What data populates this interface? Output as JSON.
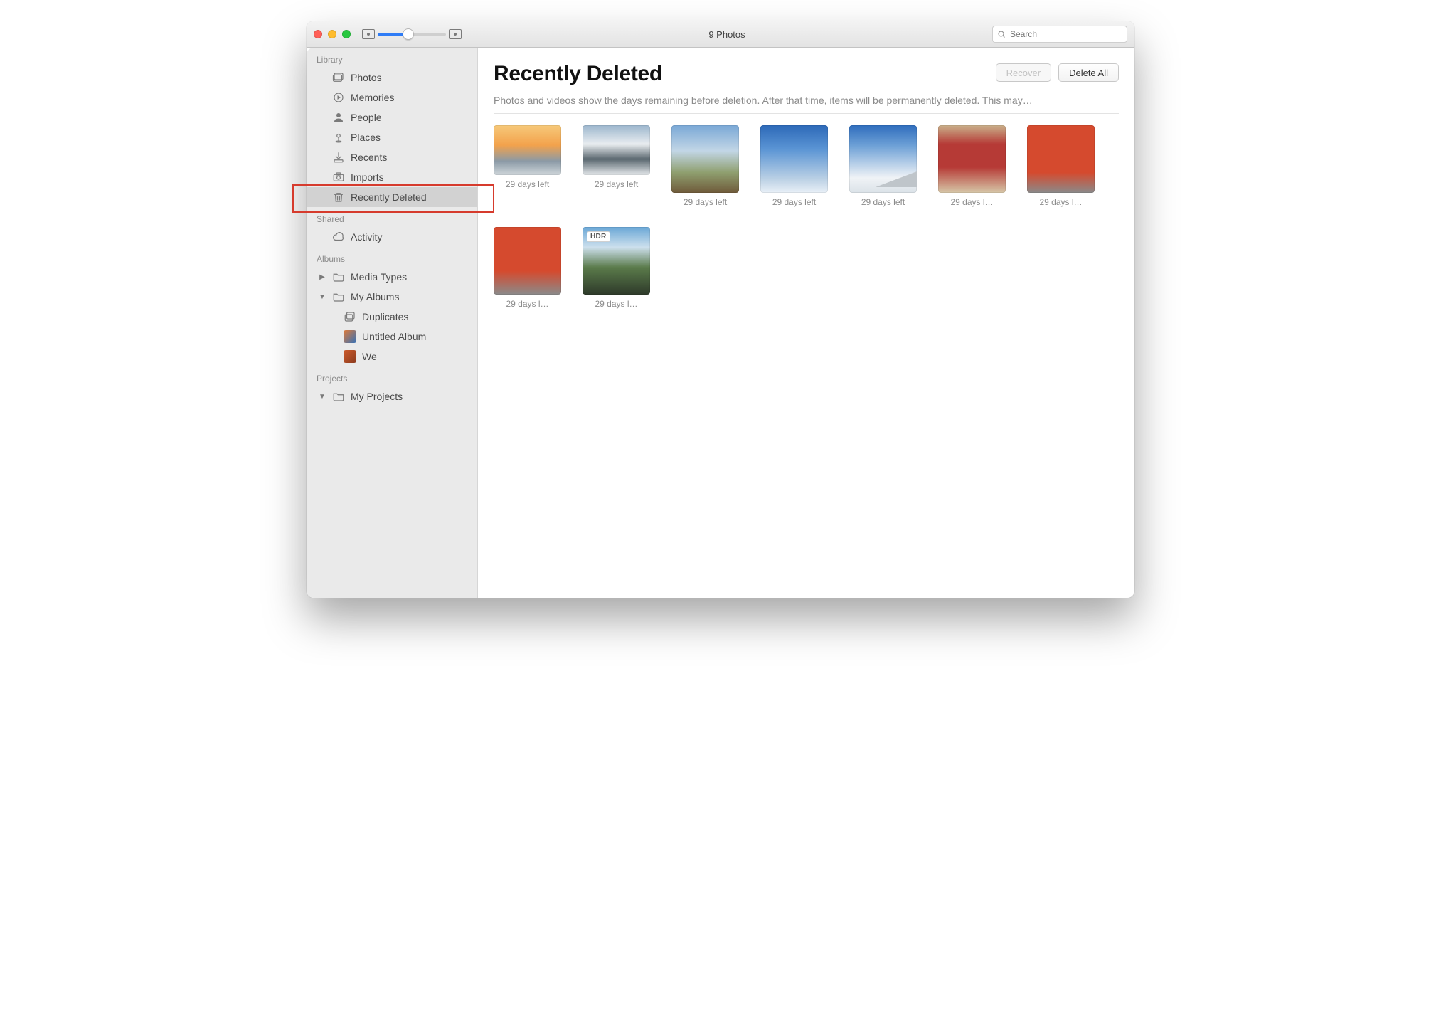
{
  "window": {
    "title": "9 Photos"
  },
  "search": {
    "placeholder": "Search"
  },
  "sidebar": {
    "sections": {
      "library": {
        "title": "Library",
        "items": [
          {
            "label": "Photos",
            "icon": "photos"
          },
          {
            "label": "Memories",
            "icon": "memories"
          },
          {
            "label": "People",
            "icon": "people"
          },
          {
            "label": "Places",
            "icon": "places"
          },
          {
            "label": "Recents",
            "icon": "recents"
          },
          {
            "label": "Imports",
            "icon": "imports"
          },
          {
            "label": "Recently Deleted",
            "icon": "trash",
            "selected": true,
            "highlighted": true
          }
        ]
      },
      "shared": {
        "title": "Shared",
        "items": [
          {
            "label": "Activity",
            "icon": "cloud"
          }
        ]
      },
      "albums": {
        "title": "Albums",
        "items": [
          {
            "label": "Media Types",
            "icon": "folder",
            "disclosure": "closed"
          },
          {
            "label": "My Albums",
            "icon": "folder",
            "disclosure": "open",
            "children": [
              {
                "label": "Duplicates",
                "icon": "stack"
              },
              {
                "label": "Untitled Album",
                "icon": "thumb-a"
              },
              {
                "label": "We",
                "icon": "thumb-b"
              }
            ]
          }
        ]
      },
      "projects": {
        "title": "Projects",
        "items": [
          {
            "label": "My Projects",
            "icon": "folder",
            "disclosure": "open"
          }
        ]
      }
    }
  },
  "main": {
    "title": "Recently Deleted",
    "subtitle": "Photos and videos show the days remaining before deletion. After that time, items will be permanently deleted. This may…",
    "buttons": {
      "recover": "Recover",
      "delete_all": "Delete All"
    },
    "items": [
      {
        "caption": "29 days left",
        "ph": "ph1"
      },
      {
        "caption": "29 days left",
        "ph": "ph2"
      },
      {
        "caption": "29 days left",
        "ph": "ph3"
      },
      {
        "caption": "29 days left",
        "ph": "ph4"
      },
      {
        "caption": "29 days left",
        "ph": "ph5"
      },
      {
        "caption": "29 days l…",
        "ph": "ph6"
      },
      {
        "caption": "29 days l…",
        "ph": "ph7"
      },
      {
        "caption": "29 days l…",
        "ph": "ph8"
      },
      {
        "caption": "29 days l…",
        "ph": "ph9",
        "badge": "HDR"
      }
    ]
  }
}
